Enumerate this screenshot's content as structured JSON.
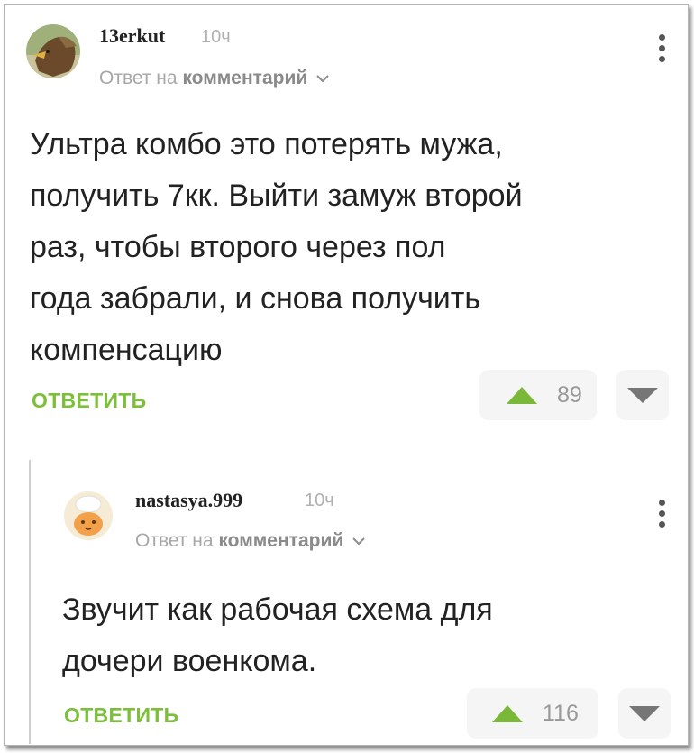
{
  "comments": [
    {
      "username": "13erkut",
      "time": "10ч",
      "reply_prefix": "Ответ на",
      "reply_target": "комментарий",
      "text_lines": [
        "Ультра комбо это потерять мужа,",
        "получить 7кк. Выйти замуж второй",
        "раз, чтобы второго через пол",
        "года забрали, и снова получить",
        "компенсацию"
      ],
      "reply_label": "ОТВЕТИТЬ",
      "votes": "89"
    },
    {
      "username": "nastasya.999",
      "time": "10ч",
      "reply_prefix": "Ответ на",
      "reply_target": "комментарий",
      "text_lines": [
        "Звучит как рабочая схема для",
        "дочери военкома."
      ],
      "reply_label": "ОТВЕТИТЬ",
      "votes": "116"
    }
  ],
  "icons": {
    "upvote": "triangle-up-icon",
    "downvote": "triangle-down-icon",
    "menu": "vertical-dots-icon",
    "chevron": "chevron-down-icon"
  },
  "colors": {
    "accent_green": "#7cbf3b",
    "upvote_green": "#7ab83a",
    "muted_gray": "#a7a7a7"
  }
}
